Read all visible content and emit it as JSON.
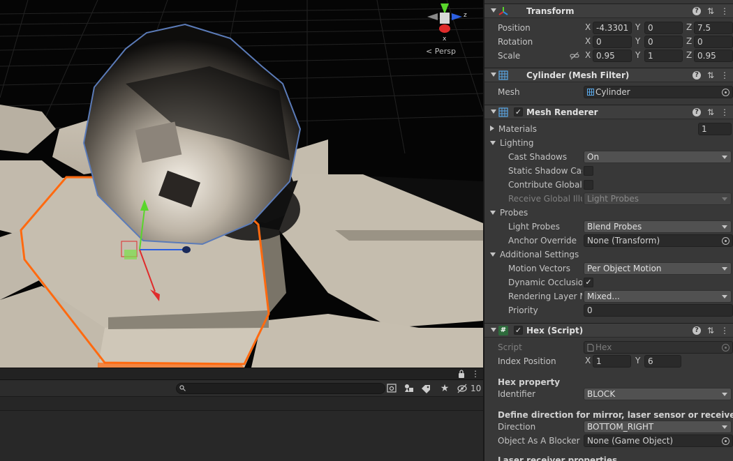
{
  "scene": {
    "gizmo_axes": {
      "x": "x",
      "z": "z"
    },
    "persp_label": "< Persp"
  },
  "bottom": {
    "count": "10"
  },
  "colors": {
    "inspector_bg": "#383838",
    "scene_bg": "#050505",
    "selection_outline": "#ff6a10",
    "sphere_outline": "#5b7bb8",
    "axis_x": "#e02b2b",
    "axis_y": "#59d62b",
    "axis_z": "#2c5fe0"
  },
  "transform": {
    "title": "Transform",
    "position": {
      "label": "Position",
      "x": "-4.3301",
      "y": "0",
      "z": "7.5"
    },
    "rotation": {
      "label": "Rotation",
      "x": "0",
      "y": "0",
      "z": "0"
    },
    "scale": {
      "label": "Scale",
      "x": "0.95",
      "y": "1",
      "z": "0.95"
    },
    "axis_labels": {
      "x": "X",
      "y": "Y",
      "z": "Z"
    }
  },
  "mesh_filter": {
    "title": "Cylinder (Mesh Filter)",
    "mesh_label": "Mesh",
    "mesh_value": "Cylinder"
  },
  "mesh_renderer": {
    "title": "Mesh Renderer",
    "materials_label": "Materials",
    "materials_count": "1",
    "lighting_label": "Lighting",
    "cast_shadows_label": "Cast Shadows",
    "cast_shadows_value": "On",
    "static_shadow_label": "Static Shadow Cas",
    "contribute_gi_label": "Contribute Global I",
    "receive_gi_label": "Receive Global Illu",
    "receive_gi_value": "Light Probes",
    "probes_label": "Probes",
    "light_probes_label": "Light Probes",
    "light_probes_value": "Blend Probes",
    "anchor_override_label": "Anchor Override",
    "anchor_override_value": "None (Transform)",
    "additional_label": "Additional Settings",
    "motion_vectors_label": "Motion Vectors",
    "motion_vectors_value": "Per Object Motion",
    "dynamic_occlusion_label": "Dynamic Occlusion",
    "rendering_layer_label": "Rendering Layer M",
    "rendering_layer_value": "Mixed...",
    "priority_label": "Priority",
    "priority_value": "0"
  },
  "hex_script": {
    "title": "Hex (Script)",
    "script_label": "Script",
    "script_value": "Hex",
    "index_position_label": "Index Position",
    "index_x": "1",
    "index_y": "6",
    "hex_property_header": "Hex property",
    "identifier_label": "Identifier",
    "identifier_value": "BLOCK",
    "direction_header": "Define direction for mirror, laser sensor or receiver",
    "direction_label": "Direction",
    "direction_value": "BOTTOM_RIGHT",
    "blocker_label": "Object As A Blocker C",
    "blocker_value": "None (Game Object)",
    "laser_header": "Laser receiver properties"
  }
}
